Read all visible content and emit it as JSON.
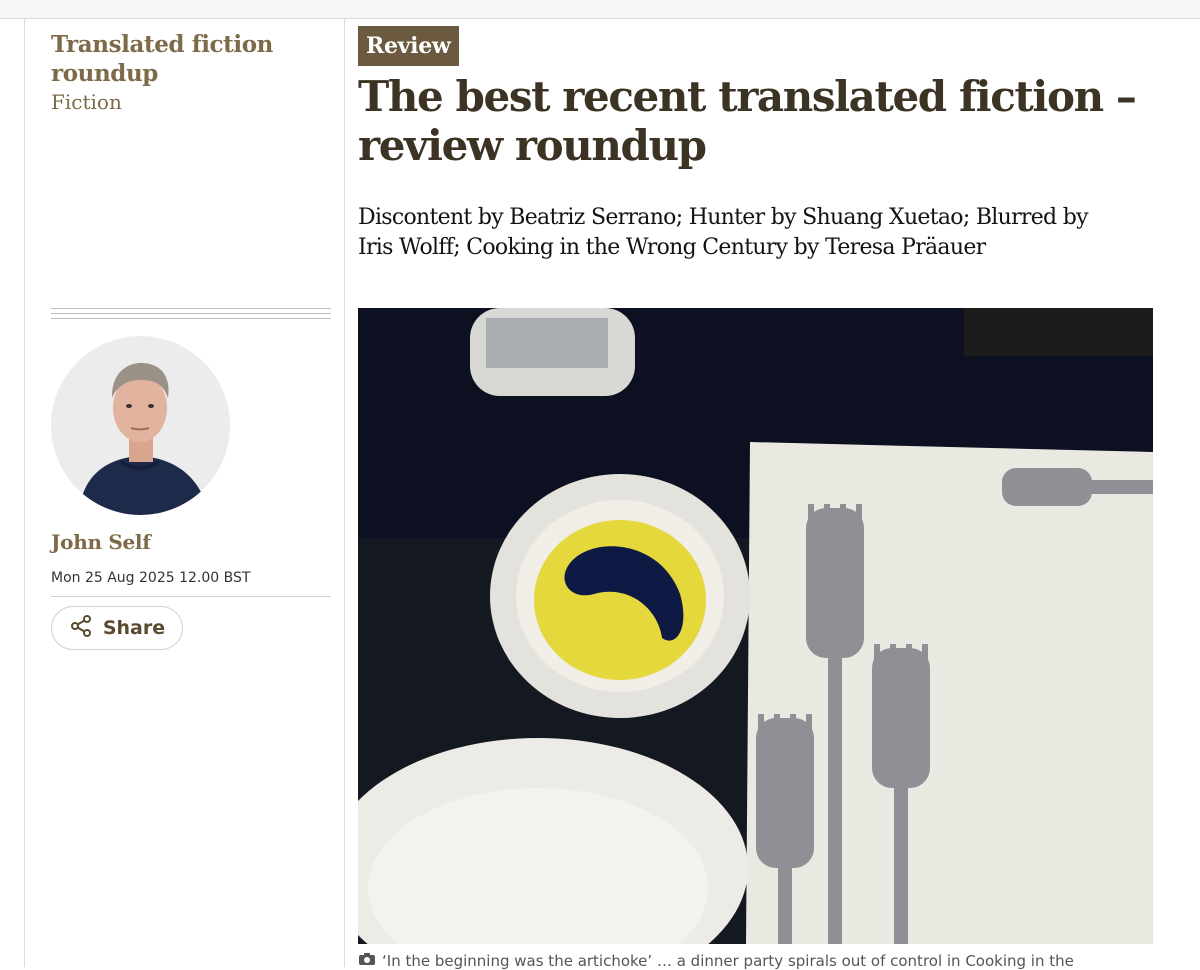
{
  "sidebar": {
    "series_title": "Translated fiction roundup",
    "section": "Fiction",
    "author_name": "John Self",
    "date": "Mon 25 Aug 2025 12.00 BST",
    "share_label": "Share"
  },
  "article": {
    "badge": "Review",
    "headline": "The best recent translated fiction – review roundup",
    "standfirst": "Discontent by Beatriz Serrano; Hunter by Shuang Xuetao; Blurred by Iris Wolff; Cooking in the Wrong Century by Teresa Präauer",
    "caption": "‘In the beginning was the artichoke’ … a dinner party spirals out of control in Cooking in the"
  },
  "icons": {
    "share": "share-icon",
    "camera": "camera-icon"
  },
  "colors": {
    "kicker": "#7d6a48",
    "badge_bg": "#6b5a3f",
    "headline": "#3d3325"
  }
}
